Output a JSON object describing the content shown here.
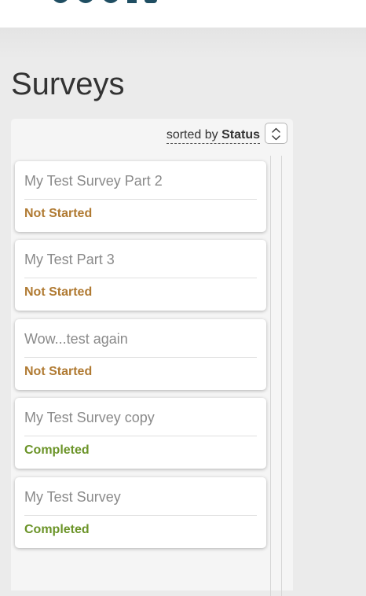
{
  "page_title": "Surveys",
  "sort": {
    "prefix": "sorted by",
    "value": "Status"
  },
  "colors": {
    "not_started": "#b07a32",
    "completed": "#6b9428",
    "logo": "#1f4e62"
  },
  "surveys": [
    {
      "title": "My Test Survey Part 2",
      "status": "Not Started"
    },
    {
      "title": "My Test Part 3",
      "status": "Not Started"
    },
    {
      "title": "Wow...test again",
      "status": "Not Started"
    },
    {
      "title": "My Test Survey copy",
      "status": "Completed"
    },
    {
      "title": "My Test Survey",
      "status": "Completed"
    }
  ]
}
